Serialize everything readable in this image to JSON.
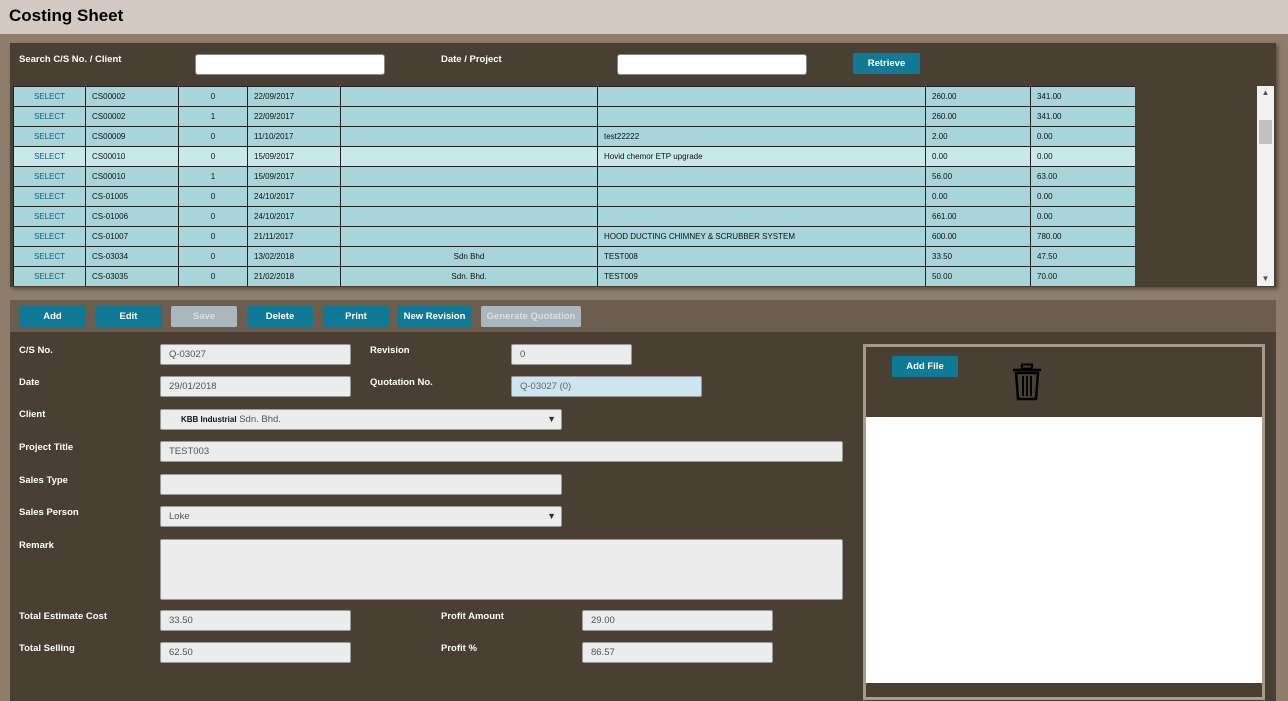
{
  "page_title": "Costing Sheet",
  "search": {
    "cs_client_label": "Search C/S No. / Client",
    "cs_client_value": "",
    "date_project_label": "Date / Project",
    "date_project_value": "",
    "retrieve_label": "Retrieve"
  },
  "grid": {
    "rows": [
      {
        "action": "SELECT",
        "cs_no": "CS00002",
        "rev": "0",
        "date": "22/09/2017",
        "client": "",
        "project": "",
        "cost": "260.00",
        "selling": "341.00"
      },
      {
        "action": "SELECT",
        "cs_no": "CS00002",
        "rev": "1",
        "date": "22/09/2017",
        "client": "",
        "project": "",
        "cost": "260.00",
        "selling": "341.00"
      },
      {
        "action": "SELECT",
        "cs_no": "CS00009",
        "rev": "0",
        "date": "11/10/2017",
        "client": "",
        "project": "test22222",
        "cost": "2.00",
        "selling": "0.00"
      },
      {
        "action": "SELECT",
        "cs_no": "CS00010",
        "rev": "0",
        "date": "15/09/2017",
        "client": "",
        "project": "Hovid chemor ETP upgrade",
        "cost": "0.00",
        "selling": "0.00"
      },
      {
        "action": "SELECT",
        "cs_no": "CS00010",
        "rev": "1",
        "date": "15/09/2017",
        "client": "",
        "project": "",
        "cost": "56.00",
        "selling": "63.00"
      },
      {
        "action": "SELECT",
        "cs_no": "CS-01005",
        "rev": "0",
        "date": "24/10/2017",
        "client": "",
        "project": "",
        "cost": "0.00",
        "selling": "0.00"
      },
      {
        "action": "SELECT",
        "cs_no": "CS-01006",
        "rev": "0",
        "date": "24/10/2017",
        "client": "",
        "project": "",
        "cost": "661.00",
        "selling": "0.00"
      },
      {
        "action": "SELECT",
        "cs_no": "CS-01007",
        "rev": "0",
        "date": "21/11/2017",
        "client": "",
        "project": "HOOD DUCTING CHIMNEY & SCRUBBER SYSTEM",
        "cost": "600.00",
        "selling": "780.00"
      },
      {
        "action": "SELECT",
        "cs_no": "CS-03034",
        "rev": "0",
        "date": "13/02/2018",
        "client": "Sdn Bhd",
        "project": "TEST008",
        "cost": "33.50",
        "selling": "47.50"
      },
      {
        "action": "SELECT",
        "cs_no": "CS-03035",
        "rev": "0",
        "date": "21/02/2018",
        "client": "Sdn. Bhd.",
        "project": "TEST009",
        "cost": "50.00",
        "selling": "70.00"
      }
    ]
  },
  "toolbar": {
    "add": "Add",
    "edit": "Edit",
    "save": "Save",
    "delete": "Delete",
    "print": "Print",
    "new_revision": "New Revision",
    "generate_quotation": "Generate Quotation"
  },
  "form": {
    "cs_no_label": "C/S No.",
    "cs_no_value": "Q-03027",
    "revision_label": "Revision",
    "revision_value": "0",
    "date_label": "Date",
    "date_value": "29/01/2018",
    "quotation_label": "Quotation No.",
    "quotation_value": "Q-03027 (0)",
    "client_label": "Client",
    "client_name": "KBB Industrial",
    "client_suffix": "Sdn. Bhd.",
    "project_title_label": "Project Title",
    "project_title_value": "TEST003",
    "sales_type_label": "Sales Type",
    "sales_type_value": "",
    "sales_person_label": "Sales Person",
    "sales_person_value": "Loke",
    "remark_label": "Remark",
    "remark_value": "",
    "total_cost_label": "Total Estimate Cost",
    "total_cost_value": "33.50",
    "profit_amount_label": "Profit Amount",
    "profit_amount_value": "29.00",
    "total_selling_label": "Total Selling",
    "total_selling_value": "62.50",
    "profit_pct_label": "Profit %",
    "profit_pct_value": "86.57"
  },
  "files": {
    "add_file_label": "Add File",
    "delete_icon": "trash-icon"
  }
}
